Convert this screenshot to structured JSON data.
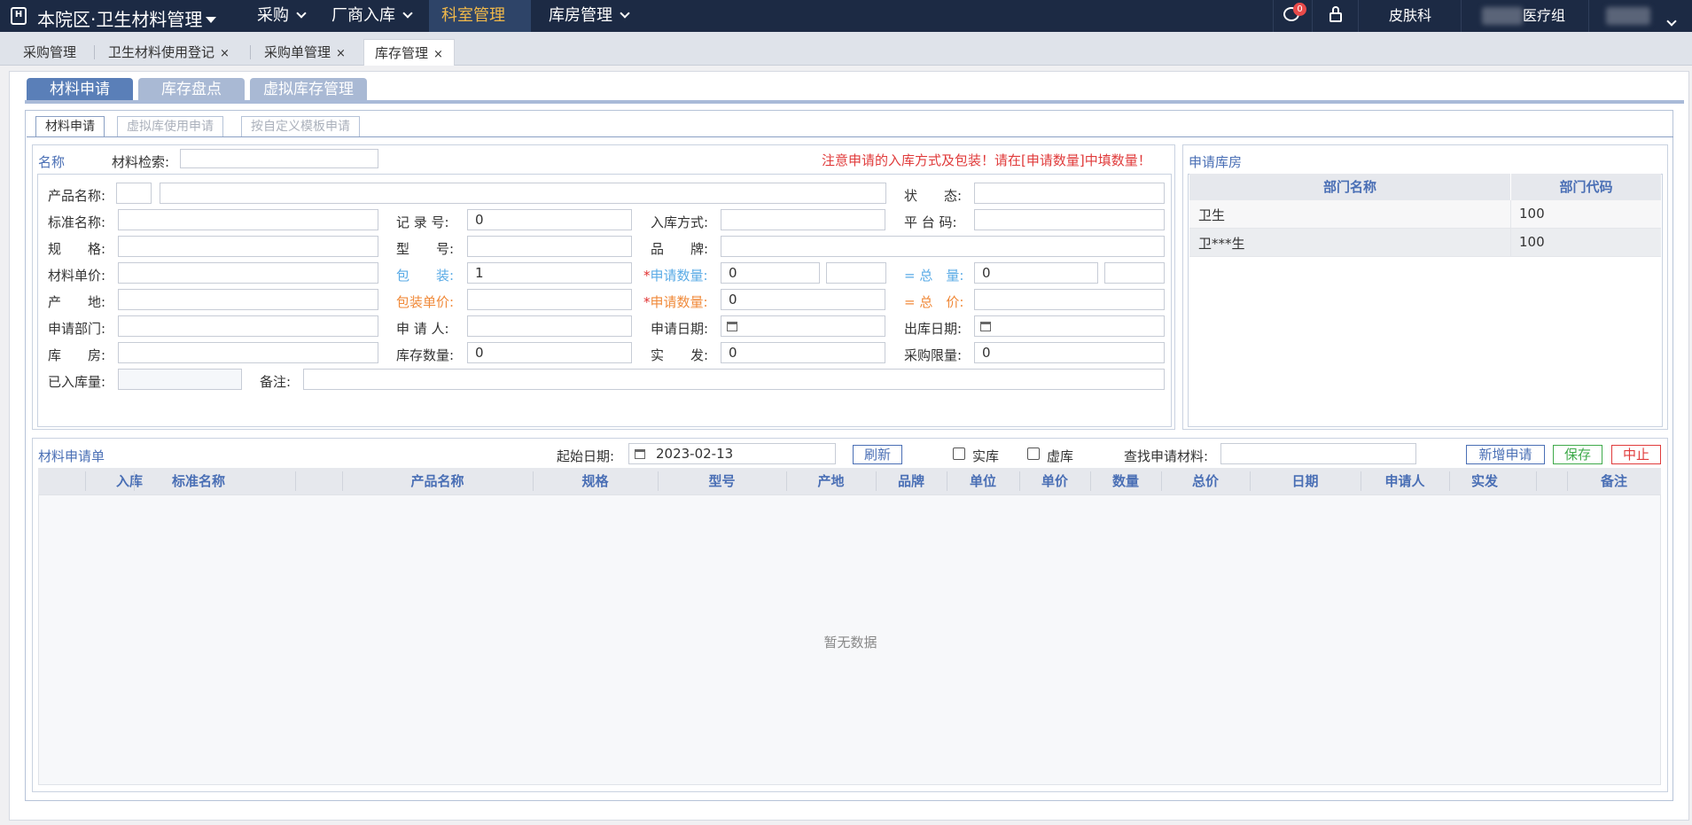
{
  "topbar": {
    "app_title": "本院区·卫生材料管理",
    "logo_text": "H",
    "nav": [
      "采购",
      "厂商入库",
      "科室管理",
      "库房管理"
    ],
    "active_nav": "科室管理",
    "message_badge": "0",
    "department": "皮肤科",
    "group": "医疗组"
  },
  "page_tabs": [
    {
      "label": "采购管理",
      "closable": false
    },
    {
      "label": "卫生材料使用登记",
      "closable": true
    },
    {
      "label": "采购单管理",
      "closable": true
    },
    {
      "label": "库存管理",
      "closable": true
    }
  ],
  "close_glyph": "×",
  "main_tabs": [
    "材料申请",
    "库存盘点",
    "虚拟库存管理"
  ],
  "sub_tabs": [
    "材料申请",
    "虚拟库使用申请",
    "按自定义模板申请"
  ],
  "form": {
    "legend": "名称",
    "search_label": "材料检索:",
    "warning": "注意申请的入库方式及包装！请在[申请数量]中填数量！",
    "labels": {
      "product_name": "产品名称:",
      "status": "状　　态:",
      "standard_name": "标准名称:",
      "record_no": "记 录 号:",
      "storage_method": "入库方式:",
      "platform_code": "平 台 码:",
      "spec": "规　　格:",
      "model": "型　　号:",
      "brand": "品　　牌:",
      "unit_price": "材料单价:",
      "package": "包　　装:",
      "apply_qty": "申请数量:",
      "total_qty": "= 总　量:",
      "origin": "产　　地:",
      "package_price": "包装单价:",
      "apply_qty2": "申请数量:",
      "total_price": "= 总　价:",
      "apply_dept": "申请部门:",
      "applicant": "申 请 人:",
      "apply_date": "申请日期:",
      "out_date": "出库日期:",
      "warehouse": "库　　房:",
      "stock_qty": "库存数量:",
      "issued": "实　　发:",
      "purchase_limit": "采购限量:",
      "stored_qty": "已入库量:",
      "remark": "备注:"
    },
    "required_mark": "*",
    "values": {
      "record_no": "0",
      "package": "1",
      "apply_qty": "0",
      "total_qty": "0",
      "apply_qty2": "0",
      "stock_qty": "0",
      "issued": "0",
      "purchase_limit": "0"
    }
  },
  "dept_panel": {
    "legend": "申请库房",
    "headers": [
      "部门名称",
      "部门代码"
    ],
    "rows": [
      {
        "name": "卫生",
        "code": "100"
      },
      {
        "name": "卫***生",
        "code": "100"
      }
    ]
  },
  "list": {
    "title": "材料申请单",
    "start_date_label": "起始日期:",
    "start_date": "2023-02-13",
    "refresh": "刷新",
    "real_stock": "实库",
    "virtual_stock": "虚库",
    "search_label": "查找申请材料:",
    "add": "新增申请",
    "save": "保存",
    "stop": "中止",
    "columns": [
      "入库",
      "标准名称",
      "产品名称",
      "规格",
      "型号",
      "产地",
      "品牌",
      "单位",
      "单价",
      "数量",
      "总价",
      "日期",
      "申请人",
      "实发",
      "备注"
    ],
    "empty_text": "暂无数据"
  }
}
